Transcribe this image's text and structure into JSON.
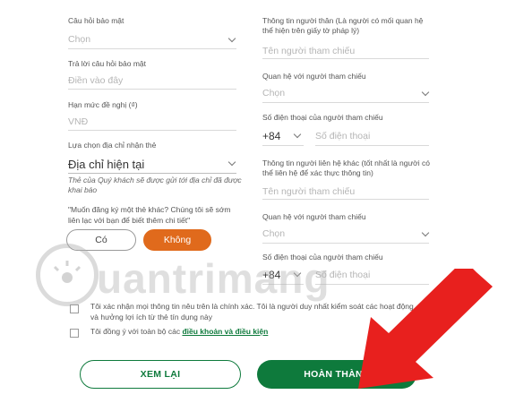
{
  "left": {
    "security_question": {
      "label": "Câu hỏi bảo mật",
      "placeholder": "Chọn"
    },
    "security_answer": {
      "label": "Trả lời câu hỏi bảo mật",
      "placeholder": "Điền vào đây"
    },
    "limit": {
      "label": "Hạn mức đề nghị (₫)",
      "placeholder": "VNĐ"
    },
    "card_address": {
      "label": "Lựa chọn địa chỉ nhận thẻ",
      "value": "Địa chỉ hiện tại",
      "hint": "Thẻ của Quý khách sẽ được gửi tới địa chỉ đã được khai báo"
    },
    "extra_card": {
      "question": "\"Muốn đăng ký một thẻ khác? Chúng tôi sẽ sớm liên lạc với bạn để biết thêm chi tiết\"",
      "yes_label": "Có",
      "no_label": "Không"
    }
  },
  "right": {
    "relative": {
      "label": "Thông tin người thân (Là người có mối quan hệ thể hiện trên giấy tờ pháp lý)",
      "placeholder": "Tên người tham chiếu"
    },
    "relationship1": {
      "label": "Quan hệ với người tham chiếu",
      "placeholder": "Chọn"
    },
    "phone1": {
      "label": "Số điện thoại của người tham chiếu",
      "code": "+84",
      "placeholder": "Số điện thoại"
    },
    "other_contact": {
      "label": "Thông tin người liên hệ khác (tốt nhất là người có thể liên hệ để xác thực thông tin)",
      "placeholder": "Tên người tham chiếu"
    },
    "relationship2": {
      "label": "Quan hệ với người tham chiếu",
      "placeholder": "Chọn"
    },
    "phone2": {
      "label": "Số điện thoại của người tham chiếu",
      "code": "+84",
      "placeholder": "Số điện thoại"
    }
  },
  "consent": {
    "confirm_text": "Tôi xác nhận mọi thông tin nêu trên là chính xác. Tôi là người duy nhất kiểm soát các hoạt động và hưởng lợi ích từ thẻ tín dụng này",
    "agree_prefix": "Tôi đồng ý với toàn bộ các ",
    "agree_link": "điều khoản và điều kiện"
  },
  "buttons": {
    "review": "XEM LẠI",
    "finish": "HOÀN THÀNH"
  },
  "watermark": {
    "text": "uantrimang"
  },
  "colors": {
    "green": "#0e7a3c",
    "orange": "#e06a1c",
    "arrow": "#e8201e"
  }
}
